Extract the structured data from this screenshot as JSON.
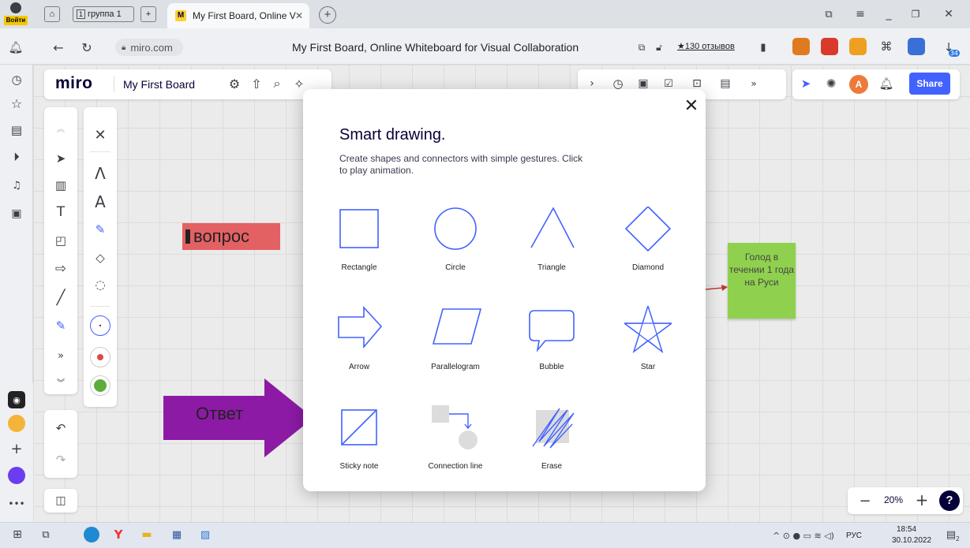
{
  "browser": {
    "login_label": "Войти",
    "tab_group_label": "группа 1",
    "tab_group_count": "1",
    "active_tab_title": "My First Board, Online V",
    "url": "miro.com",
    "page_title": "My First Board, Online Whiteboard for Visual Collaboration",
    "reviews": "★130 отзывов",
    "download_badge": "34"
  },
  "miro": {
    "logo": "miro",
    "board_name": "My First Board",
    "share_label": "Share",
    "avatar_initial": "A",
    "zoom_level": "20%",
    "help_label": "?"
  },
  "board": {
    "question_sticker": "вопрос",
    "arrow_text": "Ответ",
    "green_sticky": "Голод в течении 1 года на Руси"
  },
  "modal": {
    "title": "Smart drawing.",
    "description": "Create shapes and connectors with simple gestures. Click to play animation.",
    "shapes": [
      {
        "label": "Rectangle"
      },
      {
        "label": "Circle"
      },
      {
        "label": "Triangle"
      },
      {
        "label": "Diamond"
      },
      {
        "label": "Arrow"
      },
      {
        "label": "Parallelogram"
      },
      {
        "label": "Bubble"
      },
      {
        "label": "Star"
      },
      {
        "label": "Sticky note"
      },
      {
        "label": "Connection line"
      },
      {
        "label": "Erase"
      }
    ],
    "accent_color": "#4262ff"
  },
  "taskbar": {
    "lang": "РУС",
    "time": "18:54",
    "date": "30.10.2022",
    "notif_count": "2"
  }
}
